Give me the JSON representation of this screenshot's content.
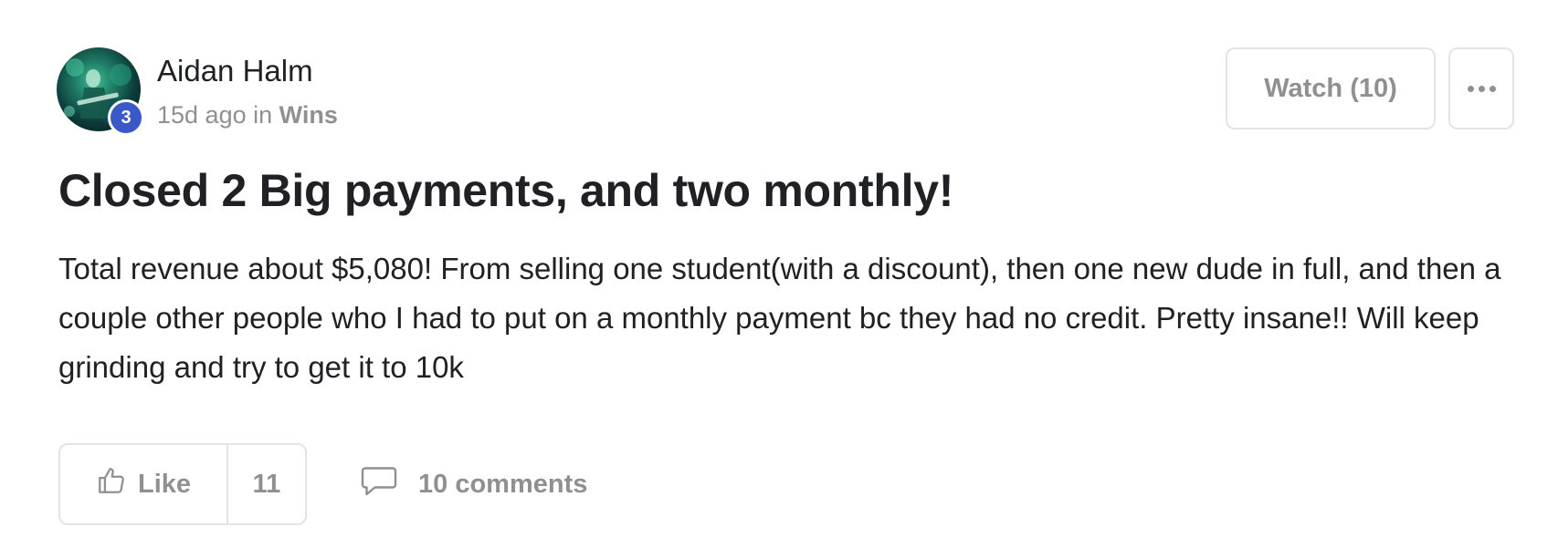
{
  "post": {
    "author": {
      "name": "Aidan Halm",
      "level": "3",
      "avatar_icon": "guitarist-photo-avatar"
    },
    "meta": {
      "time": "15d ago",
      "in_word": "in",
      "category": "Wins"
    },
    "actions": {
      "watch_label": "Watch (10)",
      "more_icon": "ellipsis-icon"
    },
    "title": "Closed 2 Big payments, and two monthly!",
    "body": "Total revenue about $5,080! From selling one student(with a discount), then one new dude in full, and then a couple other people who I had to put on a monthly payment bc they had no credit. Pretty insane!! Will keep grinding and try to get it to 10k",
    "footer": {
      "like_label": "Like",
      "like_count": "11",
      "comments_label": "10 comments",
      "like_icon": "thumbs-up-icon",
      "comment_icon": "speech-bubble-icon"
    }
  },
  "colors": {
    "badge": "#3a58c8",
    "muted_text": "#909090",
    "border": "#e4e4e4",
    "text": "#202124"
  }
}
